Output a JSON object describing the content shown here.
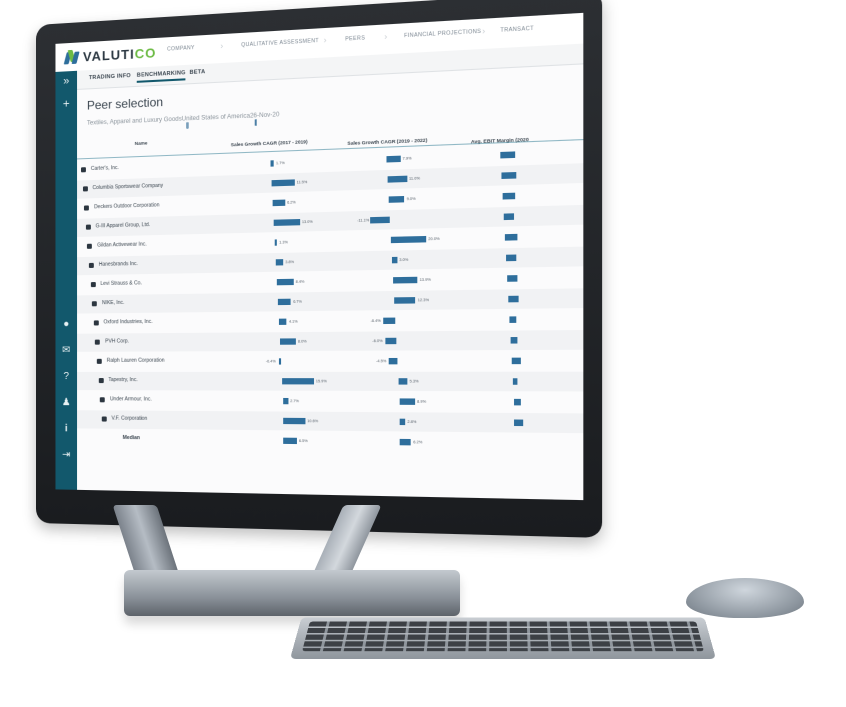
{
  "app": {
    "logo_text_a": "VALUTI",
    "logo_text_b": "CO",
    "accent": "#12586c",
    "bar_color": "#2e6e9c",
    "logo_green": "#6dbb45"
  },
  "nav": [
    {
      "label": "COMPANY"
    },
    {
      "label": "QUALITATIVE ASSESSMENT"
    },
    {
      "label": "PEERS"
    },
    {
      "label": "FINANCIAL PROJECTIONS"
    },
    {
      "label": "TRANSACT"
    }
  ],
  "subtabs": [
    {
      "label": "TRADING INFO"
    },
    {
      "label": "BENCHMARKING"
    },
    {
      "label": "BETA"
    }
  ],
  "sidebar": {
    "top_icons": [
      "chevrons-right-icon",
      "plus-icon"
    ],
    "bottom_icons": [
      "user-icon",
      "chat-icon",
      "help-icon",
      "account-icon",
      "info-icon",
      "logout-icon"
    ]
  },
  "page": {
    "title": "Peer selection",
    "crumbs": [
      "Textiles, Apparel and Luxury Goods",
      "United States of America",
      "26-Nov-20"
    ]
  },
  "table": {
    "headers": [
      "Name",
      "Sales Growth CAGR (2017 - 2019)",
      "Sales Growth CAGR (2019 - 2022)",
      "Avg. EBIT Margin (2020"
    ],
    "rows": [
      {
        "name": "Carter's, Inc.",
        "c1": 1.7,
        "c1_label": "1.7%",
        "c2": 7.9,
        "c2_label": "7.9%",
        "c3": 8
      },
      {
        "name": "Columbia Sportswear Company",
        "c1": 11.5,
        "c1_label": "11.5%",
        "c2": 11.0,
        "c2_label": "11.0%",
        "c3": 8
      },
      {
        "name": "Deckers Outdoor Corporation",
        "c1": 6.2,
        "c1_label": "6.2%",
        "c2": 9.0,
        "c2_label": "9.0%",
        "c3": 7
      },
      {
        "name": "G-III Apparel Group, Ltd.",
        "c1": 13.0,
        "c1_label": "13.0%",
        "c2": -11.1,
        "c2_label": "-11.1%",
        "c3": 6
      },
      {
        "name": "Gildan Activewear Inc.",
        "c1": 1.3,
        "c1_label": "1.3%",
        "c2": 20.0,
        "c2_label": "20.0%",
        "c3": 7
      },
      {
        "name": "Hanesbrands Inc.",
        "c1": 3.8,
        "c1_label": "3.8%",
        "c2": 3.0,
        "c2_label": "3.0%",
        "c3": 6
      },
      {
        "name": "Levi Strauss & Co.",
        "c1": 8.4,
        "c1_label": "8.4%",
        "c2": 13.9,
        "c2_label": "13.9%",
        "c3": 6
      },
      {
        "name": "NIKE, Inc.",
        "c1": 6.7,
        "c1_label": "6.7%",
        "c2": 12.3,
        "c2_label": "12.3%",
        "c3": 6
      },
      {
        "name": "Oxford Industries, Inc.",
        "c1": 4.1,
        "c1_label": "4.1%",
        "c2": -6.4,
        "c2_label": "-6.4%",
        "c3": 4
      },
      {
        "name": "PVH Corp.",
        "c1": 8.0,
        "c1_label": "8.0%",
        "c2": -6.0,
        "c2_label": "-6.0%",
        "c3": 4
      },
      {
        "name": "Ralph Lauren Corporation",
        "c1": -0.4,
        "c1_label": "-0.4%",
        "c2": -4.5,
        "c2_label": "-4.5%",
        "c3": 5
      },
      {
        "name": "Tapestry, Inc.",
        "c1": 15.9,
        "c1_label": "15.9%",
        "c2": 5.3,
        "c2_label": "5.3%",
        "c3": 3
      },
      {
        "name": "Under Armour, Inc.",
        "c1": 2.7,
        "c1_label": "2.7%",
        "c2": 8.9,
        "c2_label": "8.9%",
        "c3": 4
      },
      {
        "name": "V.F. Corporation",
        "c1": 10.6,
        "c1_label": "10.6%",
        "c2": 2.8,
        "c2_label": "2.8%",
        "c3": 5
      }
    ],
    "median": {
      "name": "Median",
      "c1": 6.5,
      "c1_label": "6.5%",
      "c2": 6.2,
      "c2_label": "6.2%"
    }
  }
}
